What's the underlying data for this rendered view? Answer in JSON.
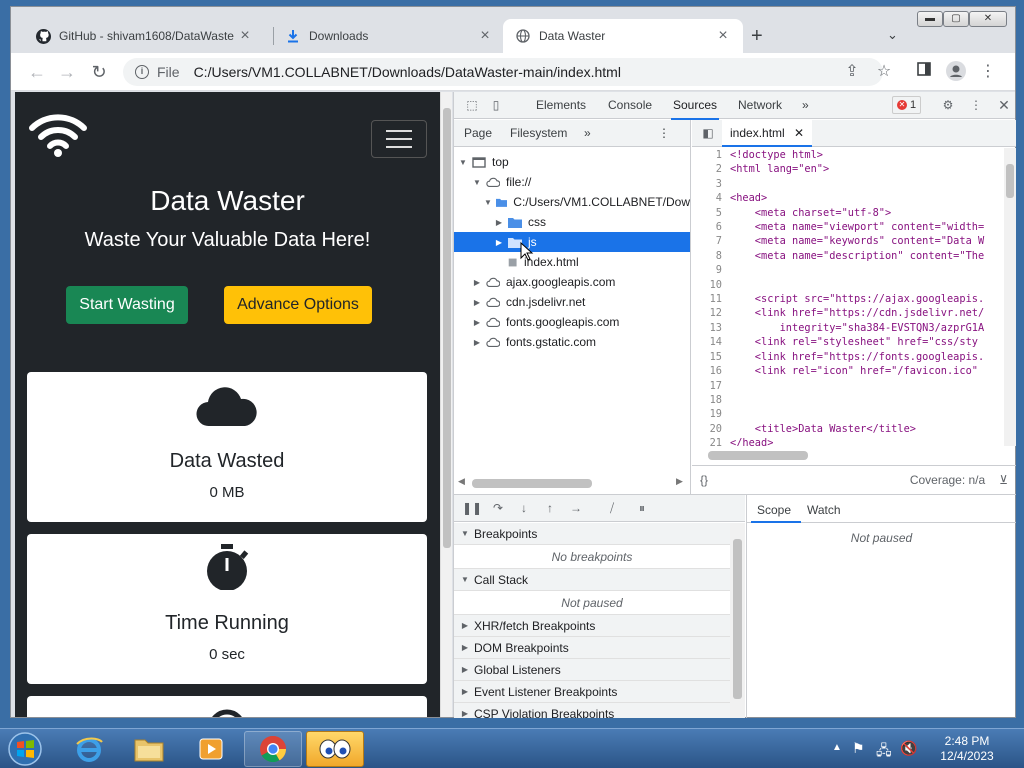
{
  "browser": {
    "tabs": [
      {
        "label": "GitHub - shivam1608/DataWaste",
        "icon": "github-icon"
      },
      {
        "label": "Downloads",
        "icon": "download-icon"
      },
      {
        "label": "Data Waster",
        "icon": "globe-icon"
      }
    ],
    "address": {
      "scheme": "File",
      "path": "C:/Users/VM1.COLLABNET/Downloads/DataWaster-main/index.html"
    }
  },
  "page": {
    "title": "Data Waster",
    "subtitle": "Waste Your Valuable Data Here!",
    "start_button": "Start Wasting",
    "advanced_button": "Advance Options",
    "cards": [
      {
        "title": "Data Wasted",
        "value": "0 MB",
        "icon": "cloud-icon"
      },
      {
        "title": "Time Running",
        "value": "0 sec",
        "icon": "stopwatch-icon"
      }
    ]
  },
  "devtools": {
    "tabs": [
      "Elements",
      "Console",
      "Sources",
      "Network"
    ],
    "active_tab": "Sources",
    "error_count": "1",
    "navigator_tabs": [
      "Page",
      "Filesystem"
    ],
    "tree": [
      {
        "label": "top",
        "depth": 0
      },
      {
        "label": "file://",
        "depth": 1
      },
      {
        "label": "C:/Users/VM1.COLLABNET/Dow",
        "depth": 2
      },
      {
        "label": "css",
        "depth": 3
      },
      {
        "label": "js",
        "depth": 3,
        "selected": true
      },
      {
        "label": "index.html",
        "depth": 3
      },
      {
        "label": "ajax.googleapis.com",
        "depth": 1
      },
      {
        "label": "cdn.jsdelivr.net",
        "depth": 1
      },
      {
        "label": "fonts.googleapis.com",
        "depth": 1
      },
      {
        "label": "fonts.gstatic.com",
        "depth": 1
      }
    ],
    "editor_file": "index.html",
    "code_lines": [
      "<!doctype html>",
      "<html lang=\"en\">",
      "",
      "<head>",
      "    <meta charset=\"utf-8\">",
      "    <meta name=\"viewport\" content=\"width=",
      "    <meta name=\"keywords\" content=\"Data W",
      "    <meta name=\"description\" content=\"The",
      "",
      "",
      "    <script src=\"https://ajax.googleapis.",
      "    <link href=\"https://cdn.jsdelivr.net/",
      "        integrity=\"sha384-EVSTQN3/azprG1A",
      "    <link rel=\"stylesheet\" href=\"css/sty",
      "    <link href=\"https://fonts.googleapis.",
      "    <link rel=\"icon\" href=\"/favicon.ico\"",
      "",
      "",
      "",
      "    <title>Data Waster</title>",
      "</head>"
    ],
    "coverage": "Coverage: n/a",
    "format_label": "{}",
    "debug_sections": [
      {
        "label": "Breakpoints",
        "open": true,
        "body": "No breakpoints"
      },
      {
        "label": "Call Stack",
        "open": true,
        "body": "Not paused"
      },
      {
        "label": "XHR/fetch Breakpoints",
        "open": false
      },
      {
        "label": "DOM Breakpoints",
        "open": false
      },
      {
        "label": "Global Listeners",
        "open": false
      },
      {
        "label": "Event Listener Breakpoints",
        "open": false
      },
      {
        "label": "CSP Violation Breakpoints",
        "open": false
      }
    ],
    "scope_tabs": [
      "Scope",
      "Watch"
    ],
    "scope_message": "Not paused"
  },
  "taskbar": {
    "time": "2:48 PM",
    "date": "12/4/2023"
  }
}
